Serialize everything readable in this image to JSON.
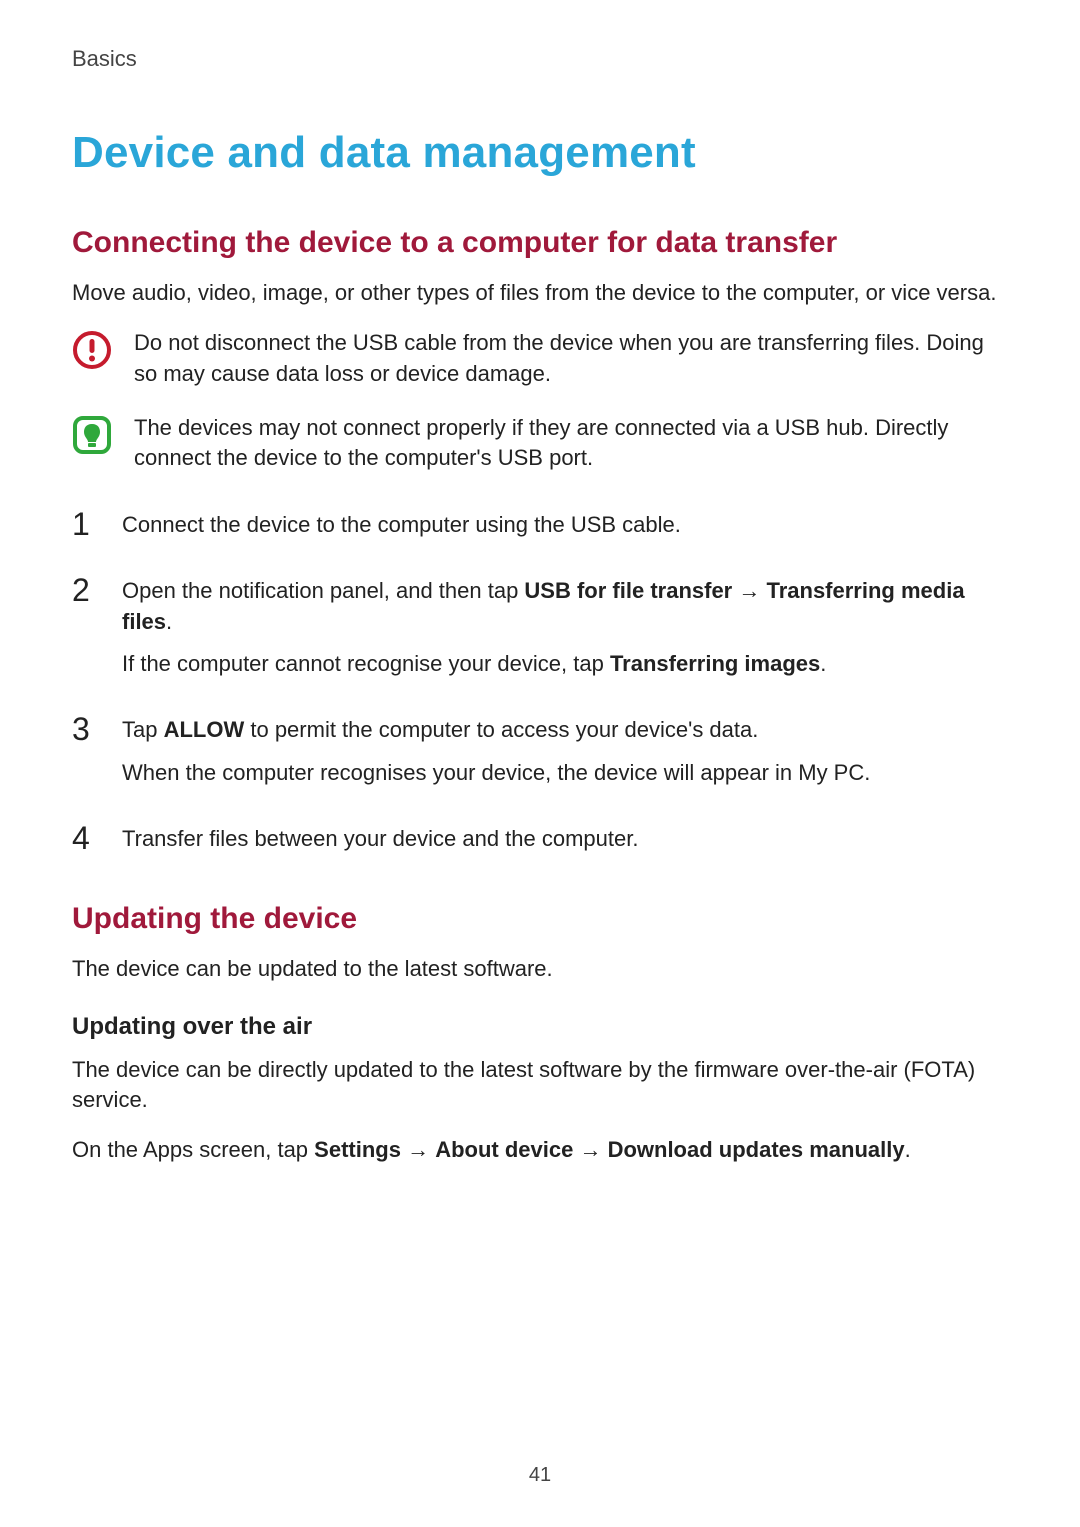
{
  "header": {
    "section": "Basics"
  },
  "title": "Device and data management",
  "section1": {
    "heading": "Connecting the device to a computer for data transfer",
    "intro": "Move audio, video, image, or other types of files from the device to the computer, or vice versa.",
    "warning": "Do not disconnect the USB cable from the device when you are transferring files. Doing so may cause data loss or device damage.",
    "note": "The devices may not connect properly if they are connected via a USB hub. Directly connect the device to the computer's USB port.",
    "steps": {
      "n1": "1",
      "t1": "Connect the device to the computer using the USB cable.",
      "n2": "2",
      "t2_a": "Open the notification panel, and then tap ",
      "t2_b": "USB for file transfer",
      "t2_arrow": " → ",
      "t2_c": "Transferring media files",
      "t2_d": ".",
      "t2_e_a": "If the computer cannot recognise your device, tap ",
      "t2_e_b": "Transferring images",
      "t2_e_c": ".",
      "n3": "3",
      "t3_a": "Tap ",
      "t3_b": "ALLOW",
      "t3_c": " to permit the computer to access your device's data.",
      "t3_d": "When the computer recognises your device, the device will appear in My PC.",
      "n4": "4",
      "t4": "Transfer files between your device and the computer."
    }
  },
  "section2": {
    "heading": "Updating the device",
    "intro": "The device can be updated to the latest software.",
    "sub_heading": "Updating over the air",
    "p1": "The device can be directly updated to the latest software by the firmware over-the-air (FOTA) service.",
    "p2_a": "On the Apps screen, tap ",
    "p2_b": "Settings",
    "p2_arrow1": " → ",
    "p2_c": "About device",
    "p2_arrow2": " → ",
    "p2_d": "Download updates manually",
    "p2_e": "."
  },
  "page_number": "41"
}
